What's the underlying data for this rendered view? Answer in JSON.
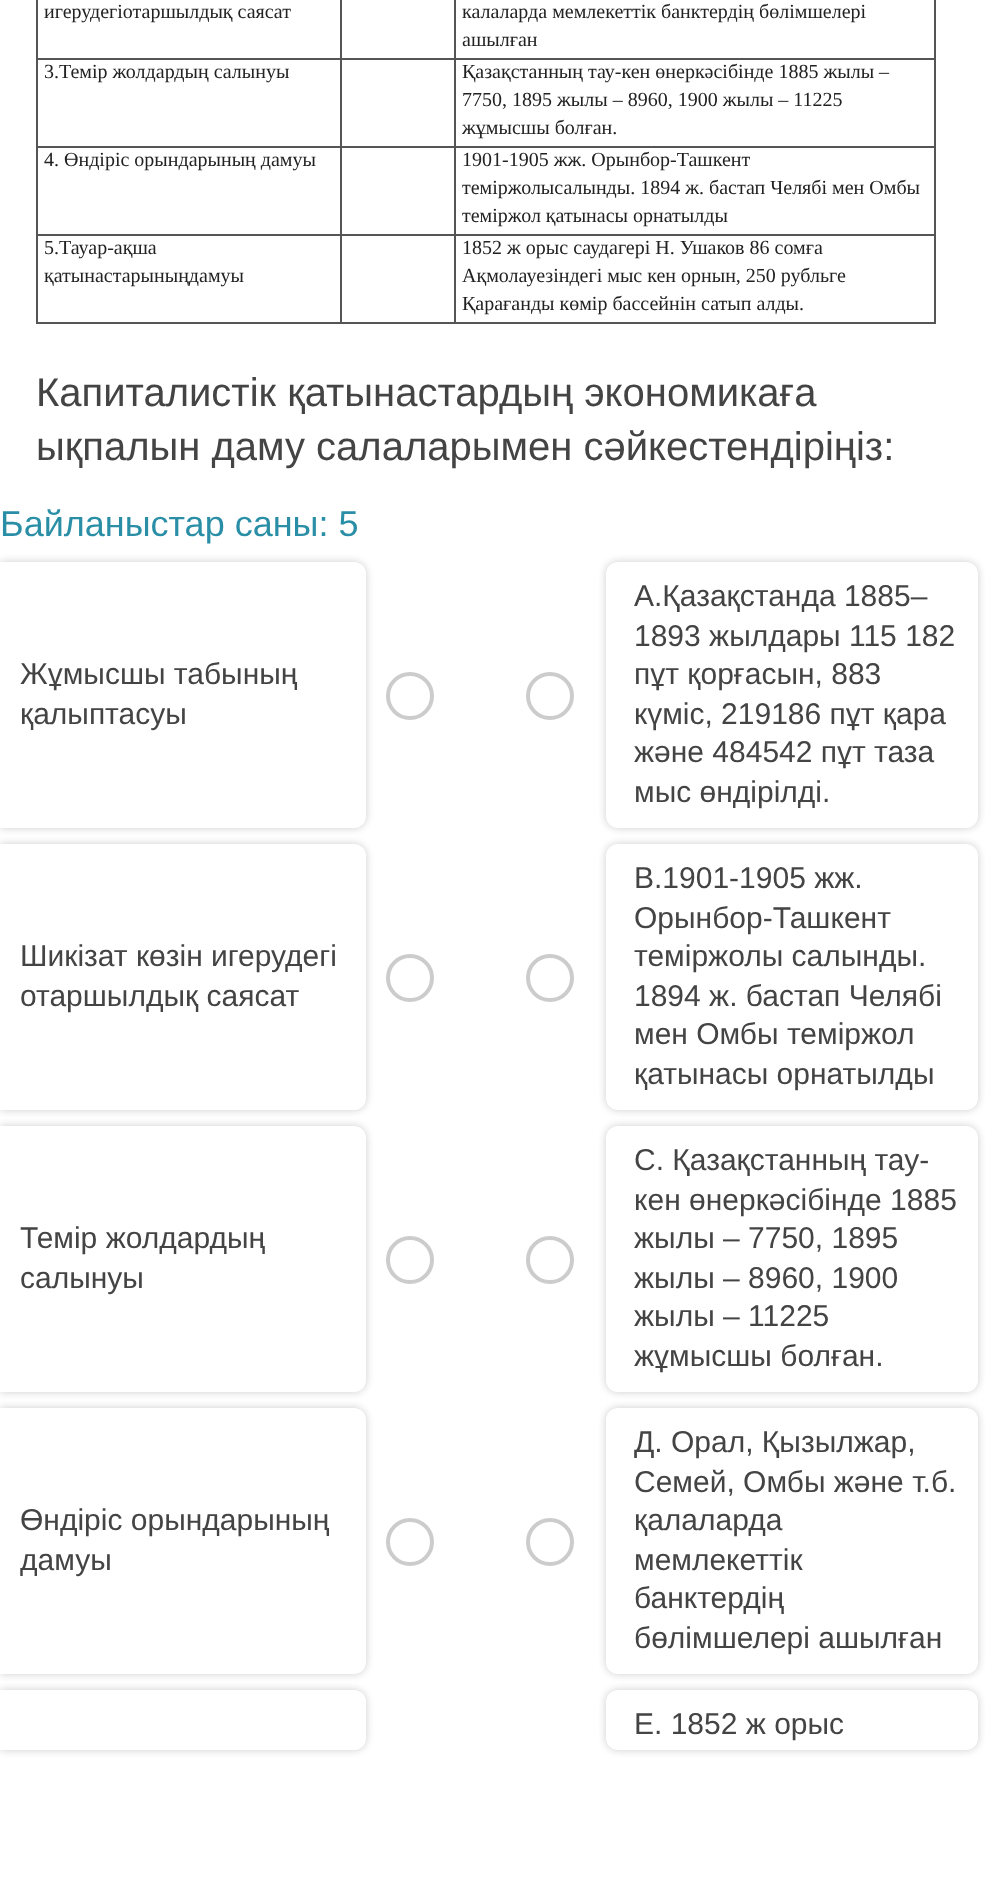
{
  "table": {
    "rows": [
      {
        "cells": [
          "игерудегіотаршылдық саясат",
          "",
          "калаларда мемлекеттік  банктердің бөлімшелері ашылған"
        ]
      },
      {
        "cells": [
          "3.Темір жолдардың салынуы",
          "",
          "Қазақстанның тау-кен өнеркәсібінде 1885 жылы –7750, 1895 жылы – 8960, 1900 жылы – 11225 жұмысшы болған."
        ]
      },
      {
        "cells": [
          "4. Өндіріс орындарының дамуы",
          "",
          "1901-1905 жж. Орынбор-Ташкент теміржолысалынды. 1894 ж. бастап Челябі мен Омбы теміржол қатынасы орнатылды"
        ]
      },
      {
        "cells": [
          "5.Тауар-ақша қатынастарыныңдамуы",
          "",
          "1852 ж орыс саудагері Н. Ушаков 86 сомға Ақмолауезіндегі мыс кен орнын, 250 рубльге Қарағанды көмір бассейнін сатып алды."
        ]
      }
    ]
  },
  "question": "Капиталистік қатынастардың экономикаға ықпалын даму салаларымен сәйкестендіріңіз:",
  "connections_count": "Байланыстар саны: 5",
  "pairs": [
    {
      "left": "Жұмысшы табының қалыптасуы",
      "right": "А.Қазақстанда 1885–1893 жылдары 115 182 пұт қорғасын, 883 күміс, 219186 пұт қара және 484542 пұт таза мыс өндірілді.",
      "left_selected": false,
      "right_selected": false
    },
    {
      "left": "Шикізат көзін игерудегі отаршылдық саясат",
      "right": "В.1901-1905 жж. Орынбор-Ташкент теміржолы салынды. 1894 ж. бастап Челябі мен Омбы теміржол қатынасы орнатылды",
      "left_selected": false,
      "right_selected": false
    },
    {
      "left": "Темір жолдардың салынуы",
      "right": "С. Қазақстанның тау-кен өнеркәсібінде 1885 жылы – 7750, 1895 жылы – 8960, 1900 жылы – 11225 жұмысшы болған.",
      "left_selected": false,
      "right_selected": false
    },
    {
      "left": "Өндіріс орындарының дамуы",
      "right": "Д. Орал, Қызылжар, Семей, Омбы және т.б. қалаларда мемлекеттік банктердің бөлімшелері ашылған",
      "left_selected": false,
      "right_selected": false
    },
    {
      "right": "Е. 1852 ж орыс"
    }
  ]
}
